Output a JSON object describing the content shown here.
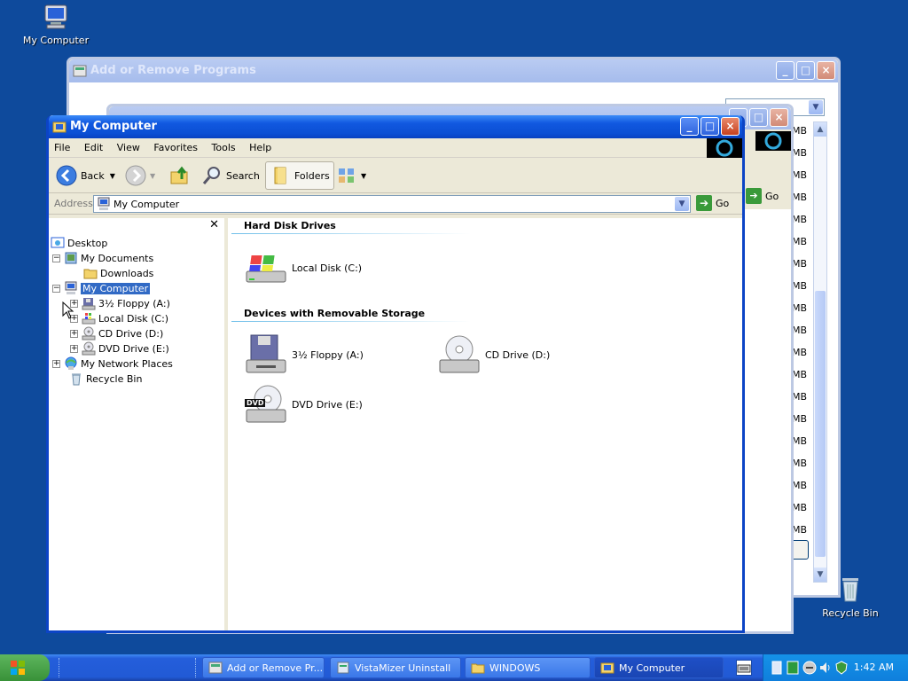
{
  "desktop": {
    "icons": [
      {
        "label": "My Computer"
      },
      {
        "label": "Recycle Bin"
      }
    ]
  },
  "bg_window_1": {
    "title": "Add or Remove Programs"
  },
  "bg_window_2": {
    "go_label": "Go"
  },
  "size_column": [
    "MB",
    "MB",
    "MB",
    "MB",
    "MB",
    "MB",
    "MB",
    "MB",
    "MB",
    "MB",
    "MB",
    "MB",
    "MB",
    "MB",
    "MB",
    "MB",
    "MB",
    "MB",
    "MB",
    "MB"
  ],
  "main_window": {
    "title": "My Computer",
    "menu": [
      "File",
      "Edit",
      "View",
      "Favorites",
      "Tools",
      "Help"
    ],
    "toolbar": {
      "back": "Back",
      "search": "Search",
      "folders": "Folders"
    },
    "address": {
      "label": "Address",
      "value": "My Computer",
      "go": "Go"
    },
    "tree": [
      {
        "label": "Desktop"
      },
      {
        "label": "My Documents"
      },
      {
        "label": "Downloads"
      },
      {
        "label": "My Computer"
      },
      {
        "label": "3½ Floppy (A:)"
      },
      {
        "label": "Local Disk (C:)"
      },
      {
        "label": "CD Drive (D:)"
      },
      {
        "label": "DVD Drive (E:)"
      },
      {
        "label": "My Network Places"
      },
      {
        "label": "Recycle Bin"
      }
    ],
    "groups": {
      "hard_disks": {
        "title": "Hard Disk Drives",
        "items": [
          {
            "label": "Local Disk (C:)"
          }
        ]
      },
      "removable": {
        "title": "Devices with Removable Storage",
        "items": [
          {
            "label": "3½ Floppy (A:)"
          },
          {
            "label": "CD Drive (D:)"
          },
          {
            "label": "DVD Drive (E:)",
            "badge": "DVD"
          }
        ]
      }
    }
  },
  "taskbar": {
    "buttons": [
      {
        "label": "Add or Remove Pr..."
      },
      {
        "label": "VistaMizer Uninstall"
      },
      {
        "label": "WINDOWS"
      },
      {
        "label": "My Computer"
      }
    ],
    "clock": "1:42 AM"
  },
  "colors": {
    "desktop": "#0e4a9c",
    "titlebar_active": "#0b4fd4",
    "selection": "#316ac5"
  }
}
